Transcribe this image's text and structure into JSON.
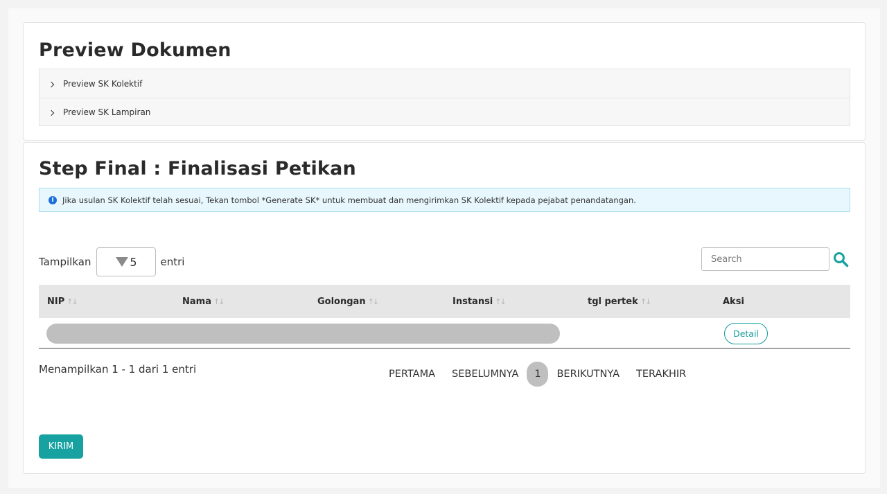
{
  "preview": {
    "title": "Preview Dokumen",
    "items": [
      {
        "label": "Preview SK Kolektif"
      },
      {
        "label": "Preview SK Lampiran"
      }
    ]
  },
  "final": {
    "title": "Step Final : Finalisasi Petikan",
    "alert": "Jika usulan SK Kolektif telah sesuai, Tekan tombol *Generate SK* untuk membuat dan mengirimkan SK Kolektif kepada pejabat penandatangan.",
    "show_prefix": "Tampilkan",
    "page_size": "5",
    "show_suffix": "entri",
    "search_placeholder": "Search",
    "columns": [
      "NIP",
      "Nama",
      "Golongan",
      "Instansi",
      "tgl pertek",
      "Aksi"
    ],
    "sort_glyph": "↑↓",
    "row_action": "Detail",
    "info": "Menampilkan 1 - 1 dari 1 entri",
    "pager": {
      "first": "PERTAMA",
      "prev": "SEBELUMNYA",
      "current": "1",
      "next": "BERIKUTNYA",
      "last": "TERAKHIR"
    },
    "submit": "KIRIM"
  },
  "colors": {
    "accent": "#17a1a1",
    "info_blue": "#1e6fd9",
    "alert_bg": "#e8f7fd"
  },
  "icons": [
    "chevron-right-icon",
    "info-icon",
    "dropdown-triangle-icon",
    "search-icon"
  ]
}
